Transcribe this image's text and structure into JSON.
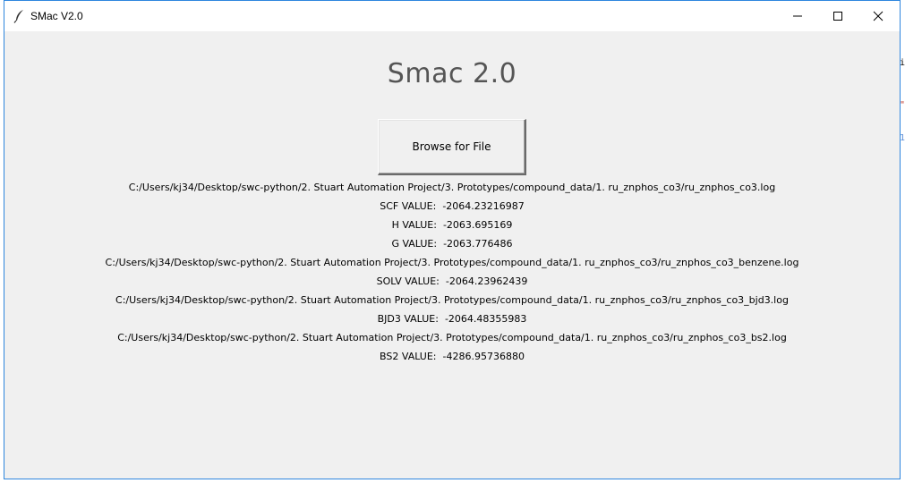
{
  "window": {
    "title": "SMac V2.0",
    "app_icon": "feather-icon",
    "controls": {
      "minimize_icon": "minimize-icon",
      "maximize_icon": "maximize-icon",
      "close_icon": "close-icon"
    }
  },
  "main": {
    "heading": "Smac 2.0",
    "browse_button_label": "Browse for File",
    "output_lines": [
      "C:/Users/kj34/Desktop/swc-python/2. Stuart Automation Project/3. Prototypes/compound_data/1. ru_znphos_co3/ru_znphos_co3.log",
      "SCF VALUE:  -2064.23216987",
      "H VALUE:  -2063.695169",
      "G VALUE:  -2063.776486",
      "C:/Users/kj34/Desktop/swc-python/2. Stuart Automation Project/3. Prototypes/compound_data/1. ru_znphos_co3/ru_znphos_co3_benzene.log",
      "SOLV VALUE:  -2064.23962439",
      "C:/Users/kj34/Desktop/swc-python/2. Stuart Automation Project/3. Prototypes/compound_data/1. ru_znphos_co3/ru_znphos_co3_bjd3.log",
      "BJD3 VALUE:  -2064.48355983",
      "C:/Users/kj34/Desktop/swc-python/2. Stuart Automation Project/3. Prototypes/compound_data/1. ru_znphos_co3/ru_znphos_co3_bs2.log",
      "BS2 VALUE:  -4286.95736880"
    ]
  },
  "background": {
    "glyphs": [
      "i",
      "\"",
      "1"
    ],
    "colors": [
      "#000000",
      "#c0392b",
      "#5b8dd6"
    ]
  }
}
